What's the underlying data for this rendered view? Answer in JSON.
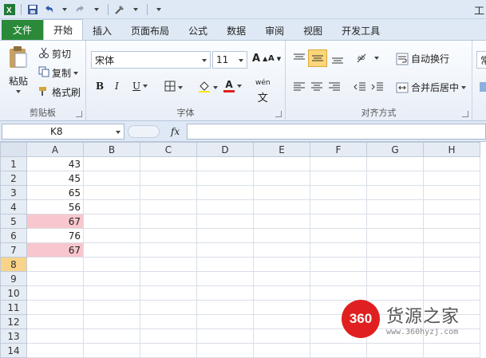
{
  "title_fragment": "工",
  "tabs": [
    {
      "label": "文件"
    },
    {
      "label": "开始"
    },
    {
      "label": "插入"
    },
    {
      "label": "页面布局"
    },
    {
      "label": "公式"
    },
    {
      "label": "数据"
    },
    {
      "label": "审阅"
    },
    {
      "label": "视图"
    },
    {
      "label": "开发工具"
    }
  ],
  "ribbon": {
    "clipboard": {
      "paste": "粘贴",
      "cut": "剪切",
      "copy": "复制",
      "format_painter": "格式刷",
      "group_label": "剪贴板"
    },
    "font": {
      "name": "宋体",
      "size": "11",
      "bold": "B",
      "italic": "I",
      "underline": "U",
      "group_label": "字体",
      "grow": "A",
      "shrink": "A",
      "font_color": "A",
      "phonetic": "wén"
    },
    "alignment": {
      "wrap_text": "自动换行",
      "merge_center": "合并后居中",
      "group_label": "对齐方式"
    },
    "number_fragment": "常"
  },
  "formula_bar": {
    "name_box": "K8",
    "fx": "fx",
    "formula": ""
  },
  "columns": [
    "A",
    "B",
    "C",
    "D",
    "E",
    "F",
    "G",
    "H"
  ],
  "rows": [
    {
      "n": "1",
      "a": "43",
      "hl": false
    },
    {
      "n": "2",
      "a": "45",
      "hl": false
    },
    {
      "n": "3",
      "a": "65",
      "hl": false
    },
    {
      "n": "4",
      "a": "56",
      "hl": false
    },
    {
      "n": "5",
      "a": "67",
      "hl": true
    },
    {
      "n": "6",
      "a": "76",
      "hl": false
    },
    {
      "n": "7",
      "a": "67",
      "hl": true
    },
    {
      "n": "8",
      "a": "",
      "hl": false
    },
    {
      "n": "9",
      "a": "",
      "hl": false
    },
    {
      "n": "10",
      "a": "",
      "hl": false
    },
    {
      "n": "11",
      "a": "",
      "hl": false
    },
    {
      "n": "12",
      "a": "",
      "hl": false
    },
    {
      "n": "13",
      "a": "",
      "hl": false
    },
    {
      "n": "14",
      "a": "",
      "hl": false
    }
  ],
  "selected_row": "8",
  "watermark": {
    "logo": "360",
    "title": "货源之家",
    "url": "www.360hyzj.com"
  },
  "colors": {
    "file_tab": "#2a8a3a",
    "highlight": "#f8c6cd",
    "selected_header": "#f7d48a",
    "watermark_red": "#e02020"
  }
}
